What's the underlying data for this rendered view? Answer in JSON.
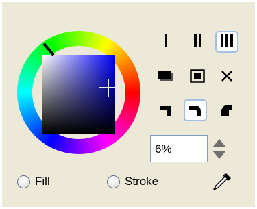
{
  "color_picker": {
    "hue_marker_icon": "hue-marker",
    "crosshair_icon": "crosshair-cursor",
    "colors": {
      "panel_bg": "#ece9d8",
      "selected_border": "#a5bfe0",
      "field_border": "#7f9db9"
    }
  },
  "stroke_width": {
    "options": [
      {
        "icon": "thin-line-icon",
        "selected": false
      },
      {
        "icon": "medium-line-icon",
        "selected": false
      },
      {
        "icon": "thick-line-icon",
        "selected": true
      }
    ]
  },
  "fill_mode": {
    "options": [
      {
        "icon": "shadow-fill-icon",
        "selected": false
      },
      {
        "icon": "framed-fill-icon",
        "selected": false
      },
      {
        "icon": "no-fill-icon",
        "selected": false
      }
    ]
  },
  "corner_style": {
    "options": [
      {
        "icon": "square-corner-icon",
        "selected": false
      },
      {
        "icon": "round-corner-icon",
        "selected": true
      },
      {
        "icon": "bevel-corner-icon",
        "selected": false
      }
    ]
  },
  "opacity": {
    "value": "6%"
  },
  "target": {
    "fill_label": "Fill",
    "stroke_label": "Stroke",
    "selected": "none"
  },
  "eyedropper_icon": "eyedropper-icon"
}
